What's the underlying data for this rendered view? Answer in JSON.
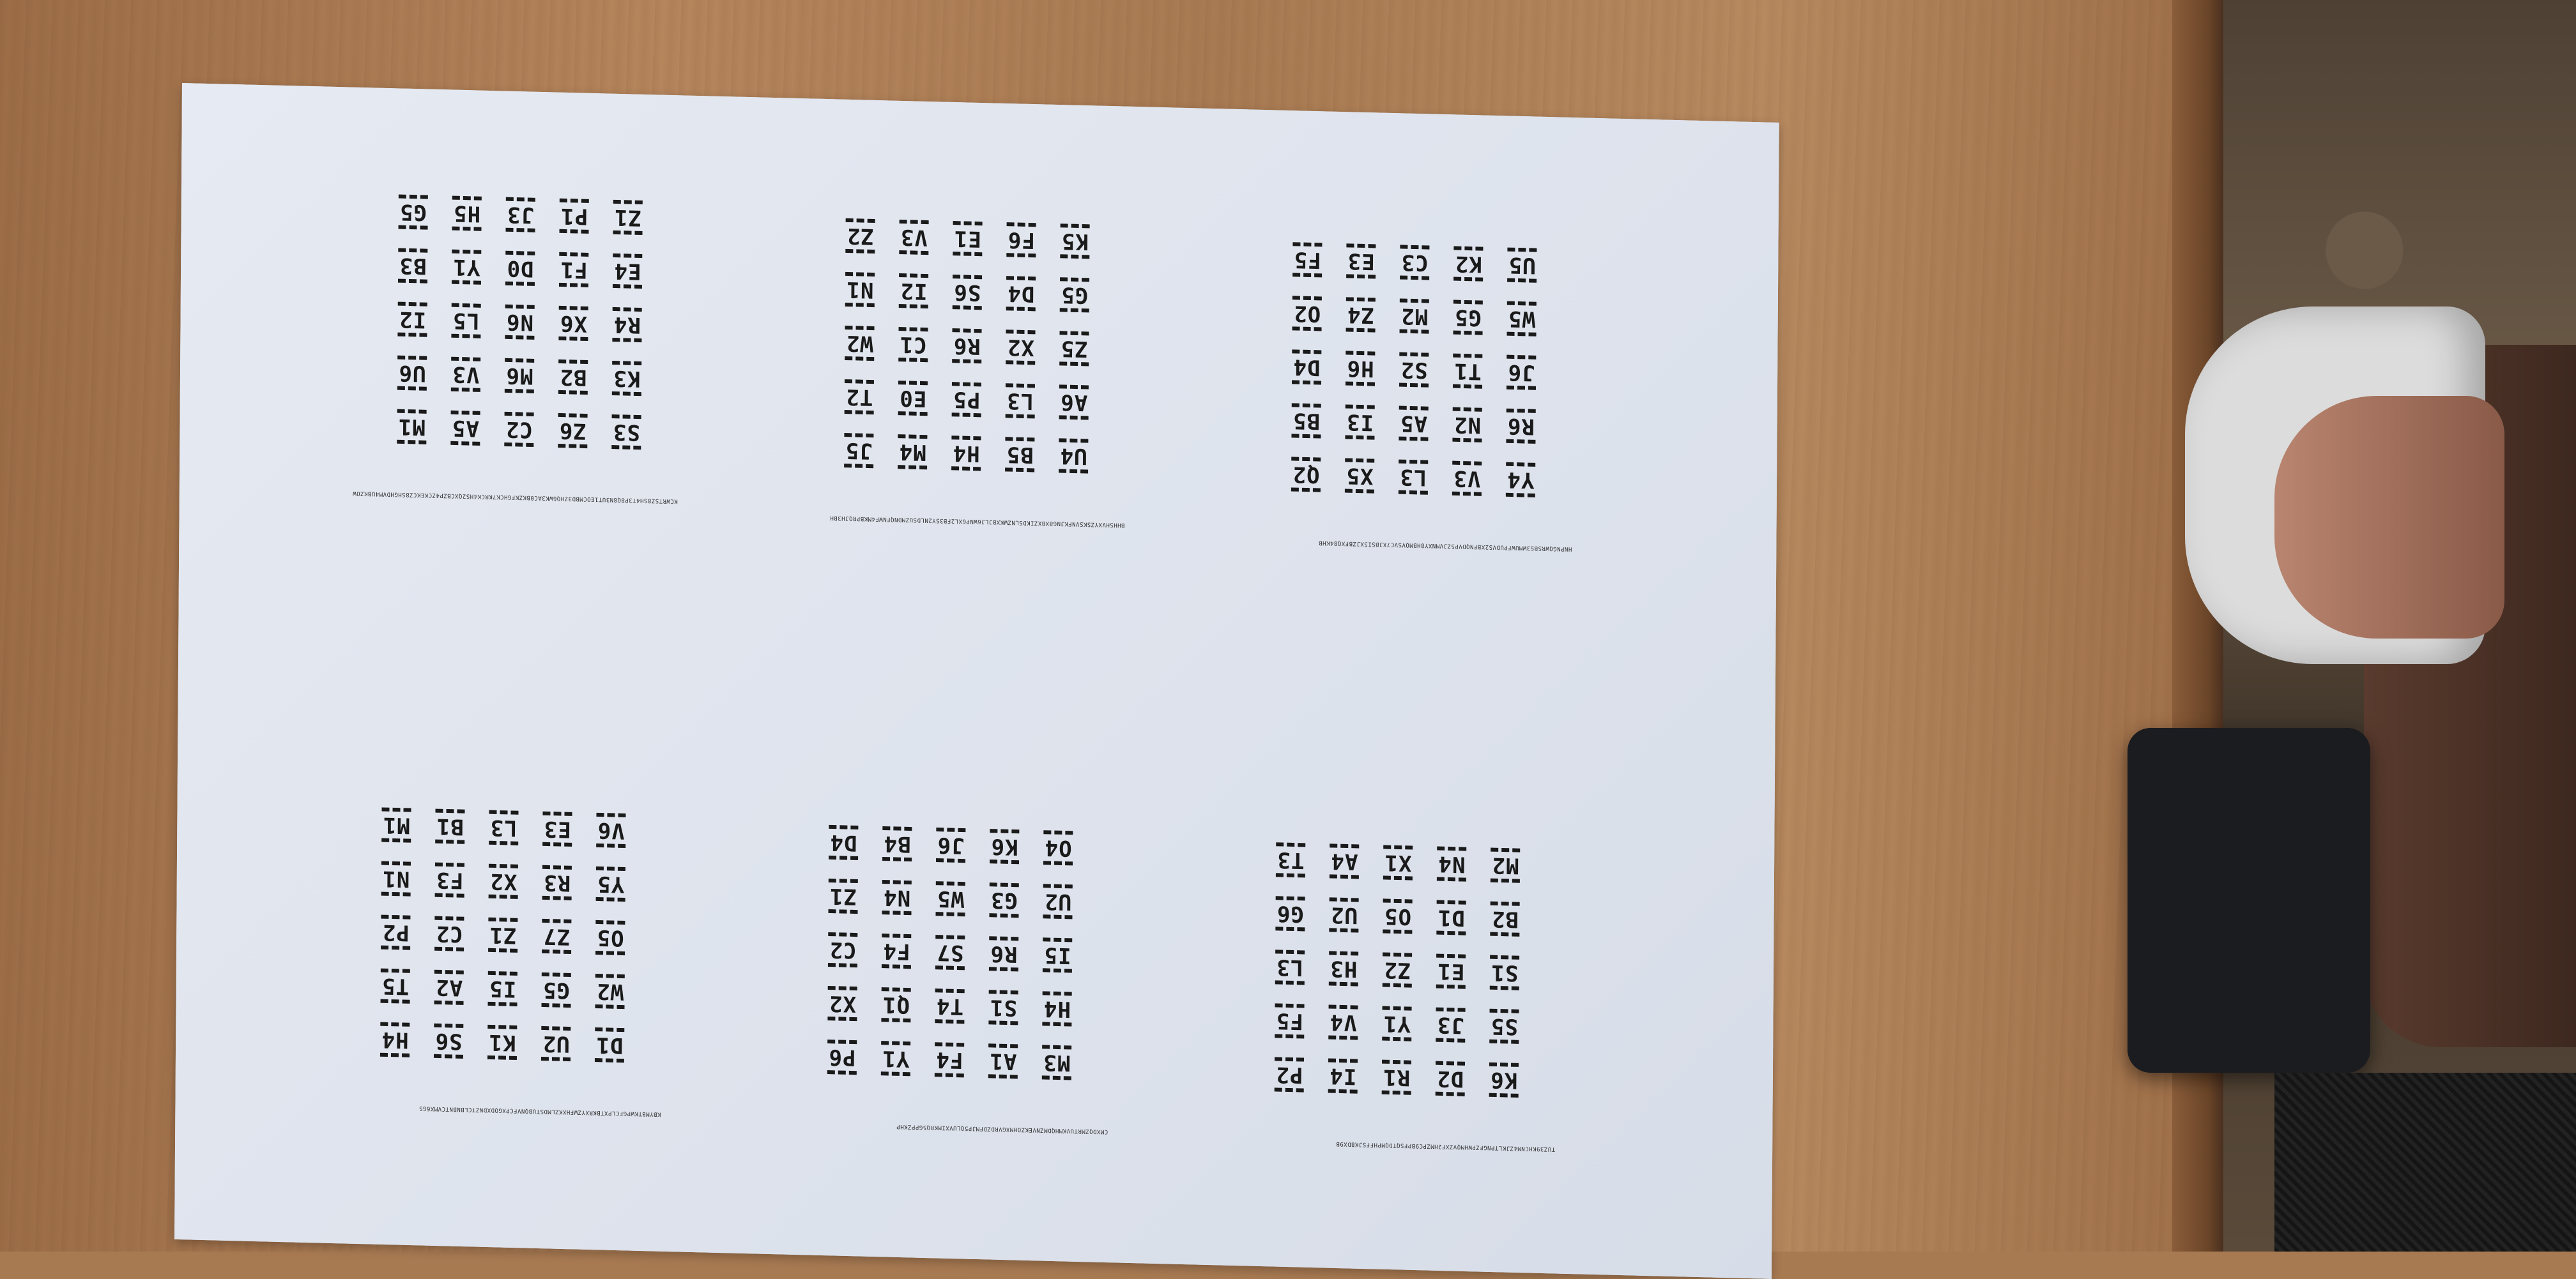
{
  "blocks": [
    {
      "serial": "KCWRTSZ8SH4T3P8Q8N3UT1EOCMBD3ZHQ6WK3AC0BKZKFGHCK7KRCK4HS2QXCBZP4ZCKEKCZ8SHGHDVM4UBKZOW",
      "tags": [
        "S3",
        "Z6",
        "C2",
        "A5",
        "M1",
        "K3",
        "B2",
        "M6",
        "V3",
        "U6",
        "R4",
        "X6",
        "N6",
        "L5",
        "I2",
        "E4",
        "F1",
        "D0",
        "Y1",
        "B3",
        "Z1",
        "P1",
        "J3",
        "H5",
        "G5"
      ]
    },
    {
      "serial": "BHHSHVXYZSKSVNFKJNG8XBXZIKDSLNZWKXBJLJ6WNP6XL2FB3SY2NLDSUZMDNQFNWF4MKBPRQJH3BH",
      "tags": [
        "U4",
        "B5",
        "H4",
        "M4",
        "J5",
        "A6",
        "L3",
        "P5",
        "E0",
        "T2",
        "Z5",
        "X2",
        "R6",
        "C1",
        "W2",
        "G5",
        "D4",
        "S6",
        "I2",
        "N1",
        "K5",
        "F6",
        "E1",
        "V3",
        "Z2"
      ]
    },
    {
      "serial": "HNPNGQWRSBS3WMUWFPUDVS2XBFNQDVP5ZJVMNXY8HBMQVSVC7XJBSI5XJZBFXQ84KHB",
      "tags": [
        "Y4",
        "V3",
        "L3",
        "X5",
        "Q2",
        "R6",
        "N2",
        "A5",
        "I3",
        "B5",
        "J6",
        "T1",
        "S2",
        "H6",
        "D4",
        "W5",
        "G5",
        "M2",
        "Z4",
        "O2",
        "U5",
        "K2",
        "C3",
        "E3",
        "F5"
      ]
    },
    {
      "serial": "KBYMBTKWPGFCLPXTBKRXYZWFHXKZLMDSTUBQNVFCPXGQDXDNZTCLBNBNTCVMX6GS",
      "tags": [
        "D1",
        "U2",
        "K1",
        "S6",
        "H4",
        "W2",
        "G5",
        "I5",
        "A2",
        "T5",
        "O5",
        "Z7",
        "Z1",
        "C2",
        "P2",
        "Y5",
        "R3",
        "X2",
        "F3",
        "N1",
        "V6",
        "E3",
        "L3",
        "B1",
        "M1"
      ]
    },
    {
      "serial": "CMXDQZMRTUVKMHQDMZNVEKZOHMXGVRDZDFMJP5QLUVXIMKRQ5GPPZKHP",
      "tags": [
        "M3",
        "A1",
        "F4",
        "Y1",
        "P6",
        "H4",
        "S1",
        "T4",
        "Q1",
        "X2",
        "I5",
        "R6",
        "S7",
        "F4",
        "C2",
        "U2",
        "G3",
        "W5",
        "N4",
        "Z1",
        "O4",
        "K6",
        "J6",
        "B4",
        "D4"
      ]
    },
    {
      "serial": "TUZ39KHCNM4ZJKLTPNGFZPWHMQVZXF2HMZPC9BPFSQTDQMPHFFSJK8DX9B",
      "tags": [
        "K6",
        "D2",
        "R1",
        "I4",
        "P2",
        "S5",
        "J3",
        "Y1",
        "V4",
        "F5",
        "S1",
        "E1",
        "Z2",
        "H3",
        "L3",
        "B2",
        "D1",
        "O5",
        "U2",
        "G6",
        "M2",
        "N4",
        "X1",
        "A4",
        "T3"
      ]
    }
  ]
}
